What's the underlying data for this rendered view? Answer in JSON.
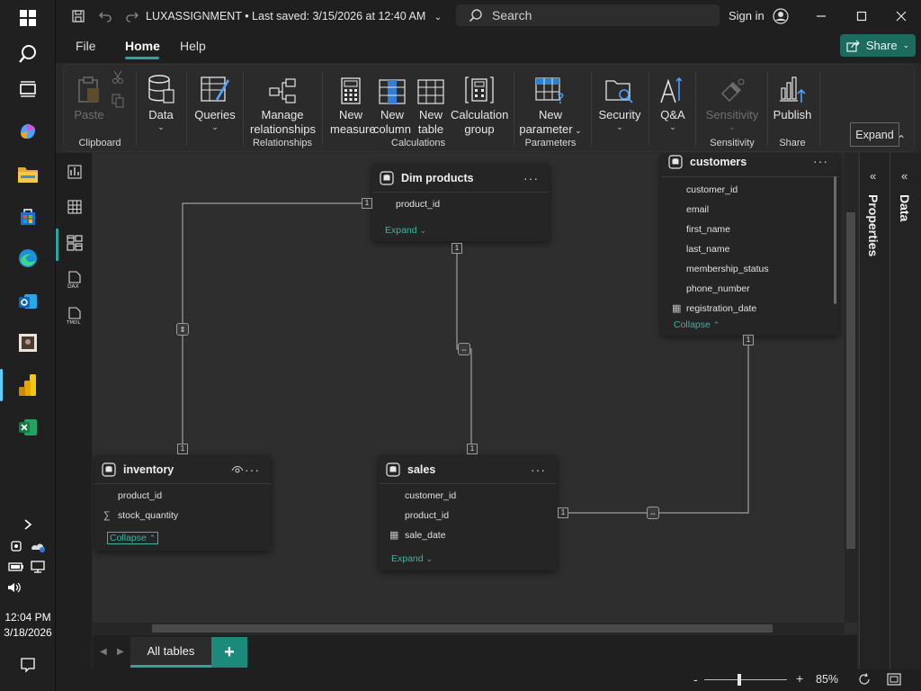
{
  "taskbar": {
    "clock_time": "12:04 PM",
    "clock_date": "3/18/2026",
    "icons": [
      "windows-start-icon",
      "search-icon",
      "task-view-icon",
      "copilot-icon",
      "file-explorer-icon",
      "microsoft-store-icon",
      "edge-icon",
      "outlook-icon",
      "photo-app-icon",
      "power-bi-icon",
      "excel-icon"
    ]
  },
  "titlebar": {
    "title": "LUXASSIGNMENT • Last saved: 3/15/2026 at 12:40 AM",
    "search_placeholder": "Search",
    "sign_in": "Sign in"
  },
  "menu": {
    "items": [
      "File",
      "Home",
      "Help"
    ],
    "active": "Home",
    "share_label": "Share"
  },
  "ribbon": {
    "buttons": {
      "paste": "Paste",
      "data": "Data",
      "queries": "Queries",
      "manage_relationships_1": "Manage",
      "manage_relationships_2": "relationships",
      "new_measure_1": "New",
      "new_measure_2": "measure",
      "new_column_1": "New",
      "new_column_2": "column",
      "new_table_1": "New",
      "new_table_2": "table",
      "calc_group_1": "Calculation",
      "calc_group_2": "group",
      "new_parameter_1": "New",
      "new_parameter_2": "parameter",
      "security": "Security",
      "qa": "Q&A",
      "sensitivity": "Sensitivity",
      "publish": "Publish"
    },
    "groups": {
      "clipboard": "Clipboard",
      "relationships": "Relationships",
      "calculations": "Calculations",
      "parameters": "Parameters",
      "sensitivity": "Sensitivity",
      "share": "Share"
    },
    "tooltip": "Expand"
  },
  "tables": {
    "dim_products": {
      "title": "Dim products",
      "fields": [
        "product_id"
      ],
      "link": "Expand"
    },
    "customers": {
      "title": "customers",
      "fields": [
        "customer_id",
        "email",
        "first_name",
        "last_name",
        "membership_status",
        "phone_number",
        "registration_date"
      ],
      "link": "Collapse"
    },
    "inventory": {
      "title": "inventory",
      "fields": [
        "product_id",
        "stock_quantity"
      ],
      "link": "Collapse"
    },
    "sales": {
      "title": "sales",
      "fields": [
        "customer_id",
        "product_id",
        "sale_date"
      ],
      "link": "Expand"
    }
  },
  "relationships": {
    "cardinality_label": "1"
  },
  "panes": {
    "properties": "Properties",
    "data": "Data"
  },
  "bottom": {
    "tab_all_tables": "All tables",
    "add_tab": "+"
  },
  "status": {
    "zoom_minus": "-",
    "zoom_plus": "+",
    "zoom_percent": "85%"
  },
  "colors": {
    "accent": "#2aa79a",
    "link": "#3fb39f",
    "share_button": "#1b6b5e",
    "powerbi_yellow": "#f2c811"
  }
}
